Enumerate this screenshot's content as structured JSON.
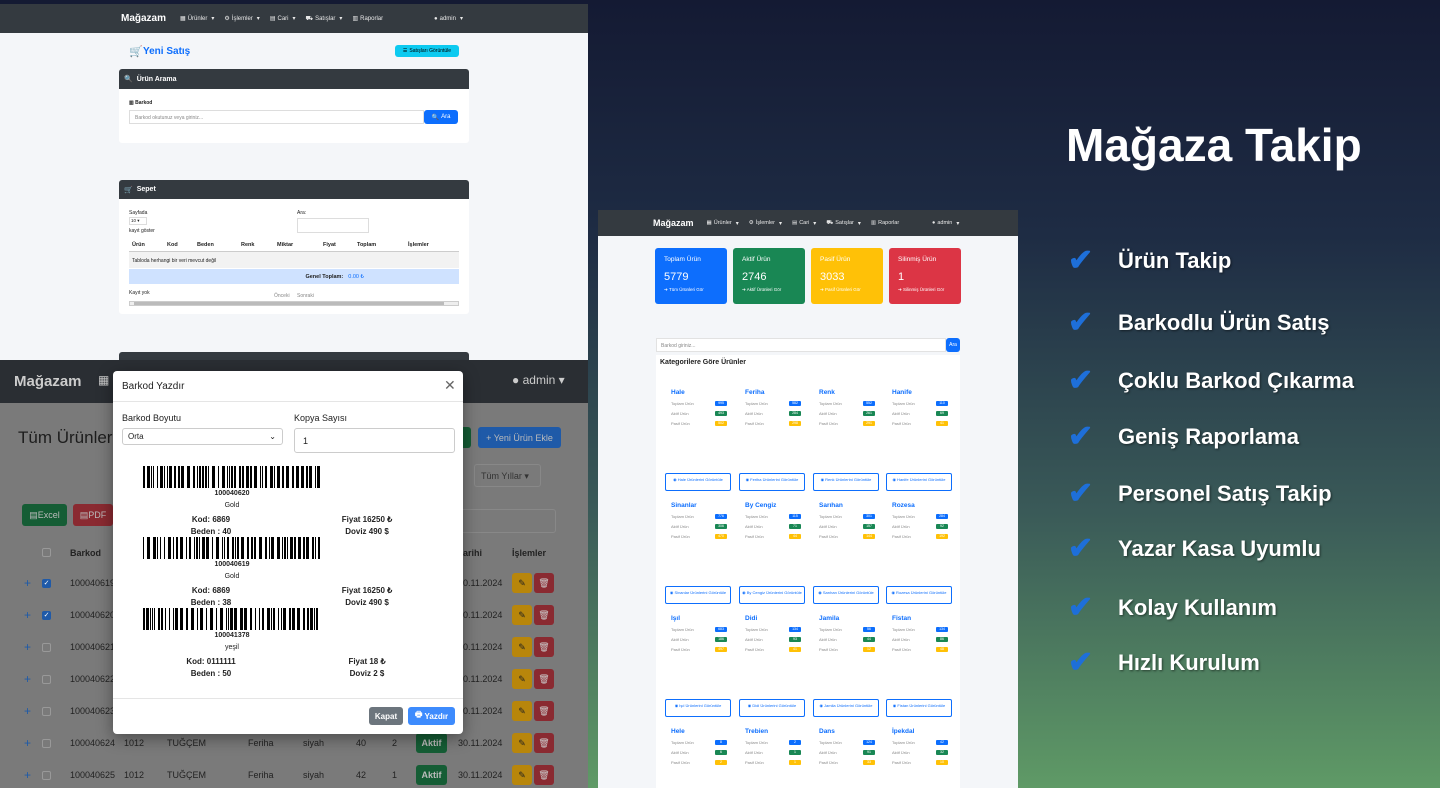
{
  "heading": "Mağaza Takip",
  "features": [
    "Ürün Takip",
    "Barkodlu Ürün Satış",
    "Çoklu Barkod Çıkarma",
    "Geniş Raporlama",
    "Personel Satış Takip",
    "Yazar Kasa Uyumlu",
    "Kolay Kullanım",
    "Hızlı Kurulum"
  ],
  "nav": {
    "brand": "Mağazam",
    "items": [
      "Ürünler",
      "İşlemler",
      "Cari",
      "Satışlar",
      "Raporlar"
    ],
    "user": "admin"
  },
  "sale": {
    "title": "Yeni Satış",
    "view_button": "Satışları Görüntüle",
    "search_header": "Ürün Arama",
    "barcode_label": "Barkod",
    "barcode_placeholder": "Barkod okutunuz veya giriniz...",
    "search_button": "Ara",
    "cart_header": "Sepet",
    "page_size_label": "Sayfada",
    "page_size": "10",
    "page_suffix": "kayıt göster",
    "filter_label": "Ara:",
    "columns": [
      "Ürün",
      "Kod",
      "Beden",
      "Renk",
      "Miktar",
      "Fiyat",
      "Toplam",
      "İşlemler"
    ],
    "empty": "Tabloda herhangi bir veri mevcut değil",
    "total_label": "Genel Toplam:",
    "total_value": "0.00 ₺",
    "info": "Kayıt yok",
    "prev": "Önceki",
    "next": "Sonraki"
  },
  "products": {
    "title": "Tüm Ürünler",
    "add_button": "+ Yeni Ürün Ekle",
    "year_filter": "Tüm Yıllar",
    "excel": "Excel",
    "pdf": "PDF",
    "col_barcode": "Barkod",
    "col_date": "arihi",
    "col_actions": "İşlemler",
    "rows": [
      {
        "barcode": "100040619",
        "checked": true,
        "date": "30.11.2024"
      },
      {
        "barcode": "100040620",
        "checked": true,
        "date": "30.11.2024"
      },
      {
        "barcode": "100040621",
        "checked": false,
        "date": "30.11.2024"
      },
      {
        "barcode": "100040622",
        "checked": false,
        "date": "30.11.2024"
      },
      {
        "barcode": "100040623",
        "checked": false,
        "date": "30.11.2024"
      },
      {
        "barcode": "100040624",
        "checked": false,
        "code": "1012",
        "name": "TUĞÇEM",
        "cat": "Feriha",
        "color": "siyah",
        "size": "40",
        "qty": "2",
        "status": "Aktif",
        "date": "30.11.2024"
      },
      {
        "barcode": "100040625",
        "checked": false,
        "code": "1012",
        "name": "TUĞÇEM",
        "cat": "Feriha",
        "color": "siyah",
        "size": "42",
        "qty": "1",
        "status": "Aktif",
        "date": "30.11.2024"
      }
    ]
  },
  "modal": {
    "title": "Barkod Yazdır",
    "size_label": "Barkod Boyutu",
    "size_value": "Orta",
    "copies_label": "Kopya Sayısı",
    "copies_value": "1",
    "labels": [
      {
        "number": "100040620",
        "color": "Gold",
        "code": "Kod: 6869",
        "price": "Fiyat 16250 ₺",
        "size": "Beden : 40",
        "fx": "Doviz 490 $"
      },
      {
        "number": "100040619",
        "color": "Gold",
        "code": "Kod: 6869",
        "price": "Fiyat 16250 ₺",
        "size": "Beden : 38",
        "fx": "Doviz 490 $"
      },
      {
        "number": "100041378",
        "color": "yeşil",
        "code": "Kod: 0111111",
        "price": "Fiyat 18 ₺",
        "size": "Beden : 50",
        "fx": "Doviz 2 $"
      }
    ],
    "close": "Kapat",
    "print": "Yazdır"
  },
  "dashboard": {
    "stats": [
      {
        "title": "Toplam Ürün",
        "value": "5779",
        "link": "➔ Tüm Ürünleri Gör",
        "color": "#0d6efd"
      },
      {
        "title": "Aktif Ürün",
        "value": "2746",
        "link": "➔ Aktif Ürünleri Gör",
        "color": "#198754"
      },
      {
        "title": "Pasif Ürün",
        "value": "3033",
        "link": "➔ Pasif Ürünleri Gör",
        "color": "#ffc107"
      },
      {
        "title": "Silinmiş Ürün",
        "value": "1",
        "link": "➔ Silinmiş Ürünleri Gör",
        "color": "#dc3545"
      }
    ],
    "search_placeholder": "Barkod giriniz...",
    "search_button": "Ara",
    "categories_title": "Kategorilere Göre Ürünler",
    "row_labels": [
      "Toplam Ürün",
      "Aktif Ürün",
      "Pasif Ürün"
    ],
    "categories": [
      {
        "name": "Hale",
        "t": "995",
        "a": "493",
        "p": "502"
      },
      {
        "name": "Feriha",
        "t": "582",
        "a": "284",
        "p": "298"
      },
      {
        "name": "Renk",
        "t": "552",
        "a": "261",
        "p": "291"
      },
      {
        "name": "Hanife",
        "t": "110",
        "a": "69",
        "p": "41"
      },
      {
        "name": "Sinanlar",
        "t": "776",
        "a": "306",
        "p": "470"
      },
      {
        "name": "By Cengiz",
        "t": "115",
        "a": "71",
        "p": "44"
      },
      {
        "name": "Sarıhan",
        "t": "301",
        "a": "157",
        "p": "144"
      },
      {
        "name": "Rozesa",
        "t": "284",
        "a": "92",
        "p": "192"
      },
      {
        "name": "Işıl",
        "t": "683",
        "a": "186",
        "p": "497"
      },
      {
        "name": "Didi",
        "t": "134",
        "a": "93",
        "p": "41"
      },
      {
        "name": "Jamila",
        "t": "56",
        "a": "44",
        "p": "12"
      },
      {
        "name": "Fistan",
        "t": "134",
        "a": "86",
        "p": "48"
      },
      {
        "name": "Hele",
        "t": "8",
        "a": "6",
        "p": "2"
      },
      {
        "name": "Trebien",
        "t": "2",
        "a": "1",
        "p": "1"
      },
      {
        "name": "Dans",
        "t": "124",
        "a": "91",
        "p": "33"
      },
      {
        "name": "İpekdal",
        "t": "42",
        "a": "32",
        "p": "10"
      }
    ],
    "view_suffix": "Ürünlerini Görüntüle"
  }
}
